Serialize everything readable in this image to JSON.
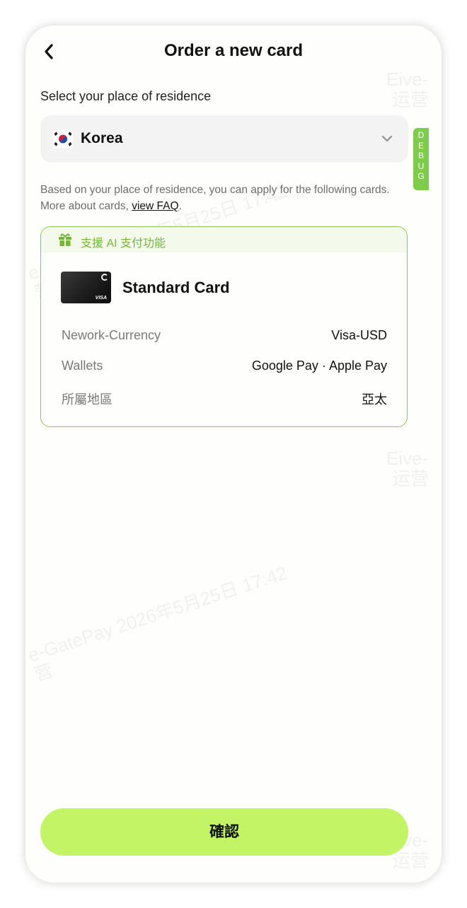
{
  "header": {
    "title": "Order a new card"
  },
  "residence": {
    "label": "Select your place of residence",
    "selected": "Korea"
  },
  "debug_label": [
    "D",
    "E",
    "B",
    "U",
    "G"
  ],
  "info": {
    "text_before_link": "Based on your place of residence, you can apply for the following cards. More about cards, ",
    "link": "view FAQ",
    "text_after_link": "."
  },
  "card": {
    "promo": "支援 AI 支付功能",
    "name": "Standard Card",
    "brand_mark": "VISA",
    "details": [
      {
        "label": "Nework-Currency",
        "value": "Visa-USD"
      },
      {
        "label": "Wallets",
        "value": "Google Pay · Apple Pay"
      },
      {
        "label": "所屬地區",
        "value": "亞太"
      }
    ]
  },
  "confirm_label": "確認",
  "watermark": {
    "prefix": "Eive-",
    "suffix": "运营",
    "diagonal": "e-GatePay 2026年5月25日 17:42",
    "diagonal_suffix": "营"
  },
  "colors": {
    "accent_green": "#c2f465",
    "border_green": "#8ac650",
    "promo_text": "#74b53d",
    "debug_tab": "#7fcc4a"
  }
}
